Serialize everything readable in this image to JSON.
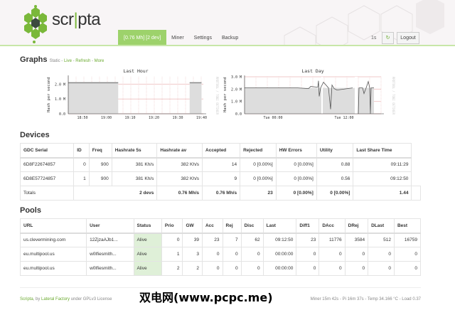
{
  "header": {
    "logo_text_a": "scr",
    "logo_text_b": "pta",
    "nav": [
      {
        "label": "[0.76 Mh] [2 dev]",
        "active": true
      },
      {
        "label": "Miner"
      },
      {
        "label": "Settings"
      },
      {
        "label": "Backup"
      }
    ],
    "interval": "1s",
    "logout": "Logout",
    "accent": "#9dd26b"
  },
  "graphs": {
    "title": "Graphs",
    "links": [
      "Static",
      "Live",
      "Refresh",
      "More"
    ],
    "sep": " - "
  },
  "chart_data": [
    {
      "type": "area",
      "title": "Last Hour",
      "ylabel": "Hash per second",
      "side_label": "RRDTOOL / TOBI OETIKER",
      "yticks": [
        "0.0",
        "1.0 M",
        "2.0 M"
      ],
      "ylim": [
        0,
        2500000
      ],
      "xticks": [
        "18:50",
        "19:00",
        "19:10",
        "19:20",
        "19:30",
        "19:40"
      ],
      "segments": [
        {
          "from": "18:44",
          "to": "19:05",
          "value": 2100000
        },
        {
          "from": "19:35",
          "to": "19:40",
          "value": 2100000
        }
      ]
    },
    {
      "type": "area",
      "title": "Last Day",
      "ylabel": "Hash per second",
      "side_label": "RRDTOOL / TOBI OETIKER",
      "yticks": [
        "0.0",
        "1.0 M",
        "2.0 M",
        "3.0 M"
      ],
      "ylim": [
        0,
        3000000
      ],
      "xticks": [
        "Tue 00:00",
        "Tue 12:00"
      ],
      "value_approx": 2100000
    }
  ],
  "devices": {
    "title": "Devices",
    "headers": [
      "GDC Serial",
      "ID",
      "Freq",
      "Hashrate 5s",
      "Hashrate av",
      "Accepted",
      "Rejected",
      "HW Errors",
      "Utility",
      "Last Share Time"
    ],
    "rows": [
      [
        "6D8F22674857",
        "0",
        "900",
        "381 Kh/s",
        "382 Kh/s",
        "14",
        "0 [0.00%]",
        "0 [0.00%]",
        "0.88",
        "09:11:29"
      ],
      [
        "6D8E57724857",
        "1",
        "900",
        "381 Kh/s",
        "382 Kh/s",
        "9",
        "0 [0.00%]",
        "0 [0.00%]",
        "0.56",
        "09:12:50"
      ]
    ],
    "totals": [
      "Totals",
      "2 devs",
      "0.76 Mh/s",
      "0.76 Mh/s",
      "23",
      "0 [0.00%]",
      "0 [0.00%]",
      "1.44"
    ]
  },
  "pools": {
    "title": "Pools",
    "headers": [
      "URL",
      "User",
      "Status",
      "Prio",
      "GW",
      "Acc",
      "Rej",
      "Disc",
      "Last",
      "Diff1",
      "DAcc",
      "DRej",
      "DLast",
      "Best"
    ],
    "rows": [
      [
        "us.clevermining.com",
        "12ZjzaAJb1...",
        "Alive",
        "0",
        "39",
        "23",
        "7",
        "62",
        "09:12:50",
        "23",
        "11776",
        "3584",
        "512",
        "16759"
      ],
      [
        "eu.multipool.us",
        "w0lfiesmith...",
        "Alive",
        "1",
        "3",
        "0",
        "0",
        "0",
        "00:00:00",
        "0",
        "0",
        "0",
        "0",
        "0"
      ],
      [
        "eu.multipool.us",
        "w0lfiesmith...",
        "Alive",
        "2",
        "2",
        "0",
        "0",
        "0",
        "00:00:00",
        "0",
        "0",
        "0",
        "0",
        "0"
      ]
    ]
  },
  "footer": {
    "scripta": "Scripta",
    "by": ", by ",
    "lateral": "Lateral Factory",
    "license": " under GPLv3 License",
    "status": "Miner 15m 42s  -  Pi 16m 37s  -  Temp 34.166 °C  -  Load 0.37",
    "watermark": "双电网(www.pcpc.me)"
  }
}
